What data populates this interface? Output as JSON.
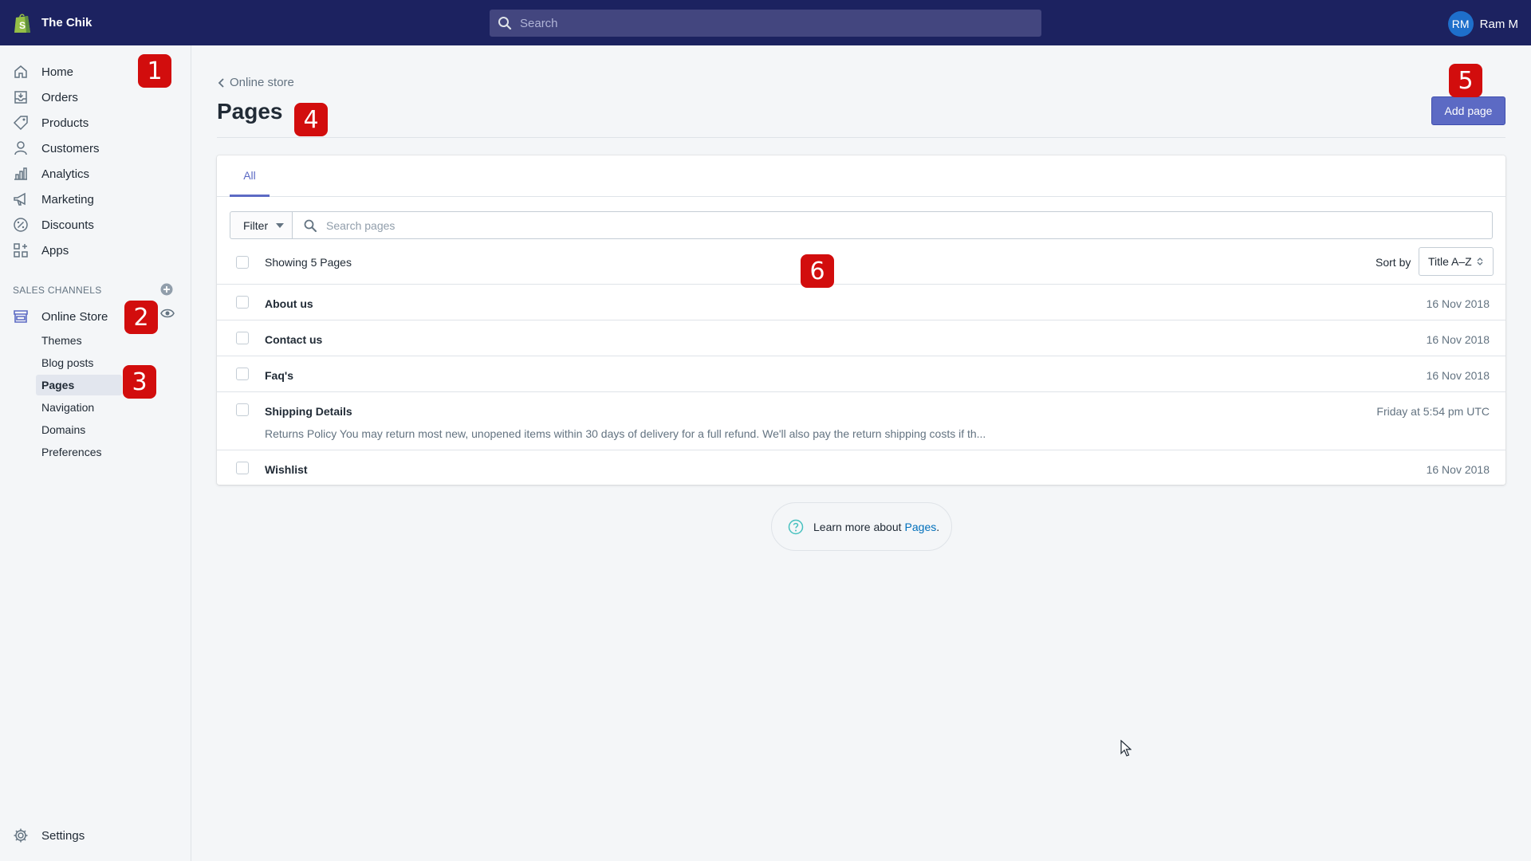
{
  "topbar": {
    "store_name": "The Chik",
    "search_placeholder": "Search",
    "user_initials": "RM",
    "user_name": "Ram M"
  },
  "sidebar": {
    "items": [
      {
        "label": "Home",
        "icon": "home-icon"
      },
      {
        "label": "Orders",
        "icon": "orders-icon"
      },
      {
        "label": "Products",
        "icon": "tag-icon"
      },
      {
        "label": "Customers",
        "icon": "person-icon"
      },
      {
        "label": "Analytics",
        "icon": "bar-chart-icon"
      },
      {
        "label": "Marketing",
        "icon": "megaphone-icon"
      },
      {
        "label": "Discounts",
        "icon": "discount-icon"
      },
      {
        "label": "Apps",
        "icon": "apps-icon"
      }
    ],
    "section_heading": "SALES CHANNELS",
    "channel": {
      "label": "Online Store",
      "icon": "store-icon"
    },
    "sub_items": [
      "Themes",
      "Blog posts",
      "Pages",
      "Navigation",
      "Domains",
      "Preferences"
    ],
    "active_sub_item": "Pages",
    "settings": {
      "label": "Settings",
      "icon": "gear-icon"
    }
  },
  "badges": [
    "1",
    "2",
    "3",
    "4",
    "5",
    "6"
  ],
  "main": {
    "breadcrumb": "Online store",
    "title": "Pages",
    "add_button": "Add page",
    "tab_all": "All",
    "filter_label": "Filter",
    "search_placeholder": "Search pages",
    "showing": "Showing 5 Pages",
    "sort_label": "Sort by",
    "sort_value": "Title A–Z",
    "rows": [
      {
        "title": "About us",
        "date": "16 Nov 2018",
        "excerpt": ""
      },
      {
        "title": "Contact us",
        "date": "16 Nov 2018",
        "excerpt": ""
      },
      {
        "title": "Faq's",
        "date": "16 Nov 2018",
        "excerpt": ""
      },
      {
        "title": "Shipping Details",
        "date": "Friday at 5:54 pm UTC",
        "excerpt": "Returns Policy You may return most new, unopened items within 30 days of delivery for a full refund. We'll also pay the return shipping costs if th..."
      },
      {
        "title": "Wishlist",
        "date": "16 Nov 2018",
        "excerpt": ""
      }
    ],
    "learn_text": "Learn more about",
    "learn_link": "Pages",
    "learn_suffix": "."
  },
  "colors": {
    "topbar": "#1c2260",
    "accent": "#5c6ac4",
    "badge": "#d20d0d",
    "link": "#006fbb"
  }
}
